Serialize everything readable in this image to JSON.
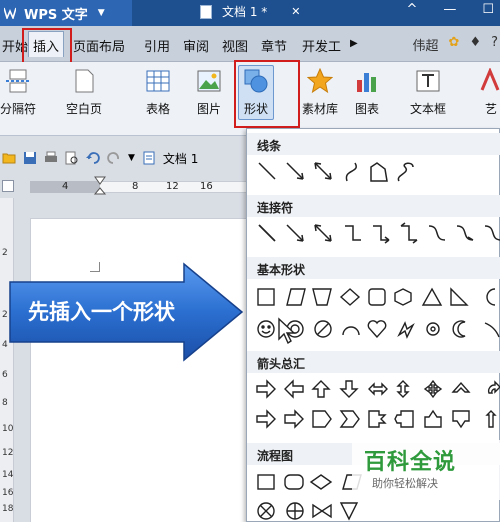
{
  "titlebar": {
    "app_name": "WPS 文字",
    "document_tab": "文档 1 *",
    "controls": [
      "^",
      "—",
      "☐",
      "✕"
    ]
  },
  "menubar": {
    "items": [
      "开始",
      "插入",
      "页面布局",
      "引用",
      "审阅",
      "视图",
      "章节",
      "开发工"
    ],
    "active": "插入",
    "user": "伟超",
    "help": "?"
  },
  "ribbon": {
    "buttons": [
      "分隔符",
      "空白页",
      "表格",
      "图片",
      "形状",
      "素材库",
      "图表",
      "文本框",
      "艺"
    ],
    "highlighted": "形状"
  },
  "quickbar": {
    "document_name": "文档 1"
  },
  "ruler": {
    "numbers": [
      "4",
      "8",
      "12",
      "16"
    ],
    "vertical_numbers": [
      "2",
      "2",
      "4",
      "6",
      "8",
      "10",
      "12",
      "14",
      "16",
      "18"
    ]
  },
  "callout": {
    "text": "先插入一个形状",
    "color": "#2b6fd0"
  },
  "shapes_panel": {
    "sections": [
      "线条",
      "连接符",
      "基本形状",
      "箭头总汇",
      "流程图"
    ]
  },
  "watermark": {
    "title": "百科全说",
    "subtitle": "助你轻松解决"
  },
  "colors": {
    "highlight_border": "#d21d1d",
    "title_bar": "#1e4f8f"
  }
}
